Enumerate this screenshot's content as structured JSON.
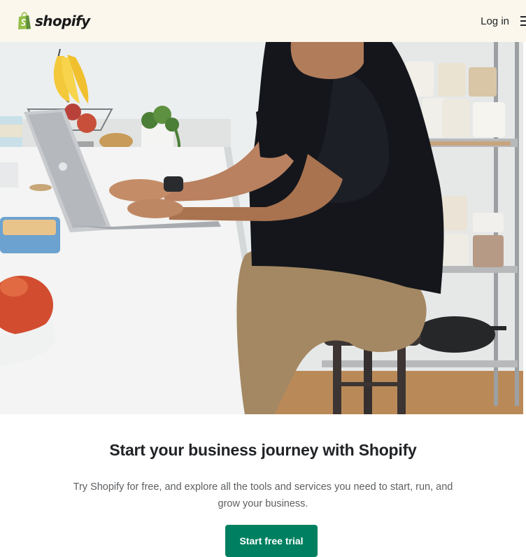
{
  "header": {
    "brand_name": "shopify",
    "login_label": "Log in",
    "menu_icon": "hamburger-menu-icon",
    "background_color": "#fbf7ed"
  },
  "hero": {
    "image": "photo-man-typing-on-laptop-at-kitchen-counter"
  },
  "main": {
    "headline": "Start your business journey with Shopify",
    "subcopy": "Try Shopify for free, and explore all the tools and services you need to start, run, and grow your business.",
    "cta_label": "Start free trial"
  },
  "colors": {
    "brand_green": "#95bf47",
    "cta_green": "#008060",
    "text_dark": "#212326",
    "text_muted": "#5c5f62"
  }
}
